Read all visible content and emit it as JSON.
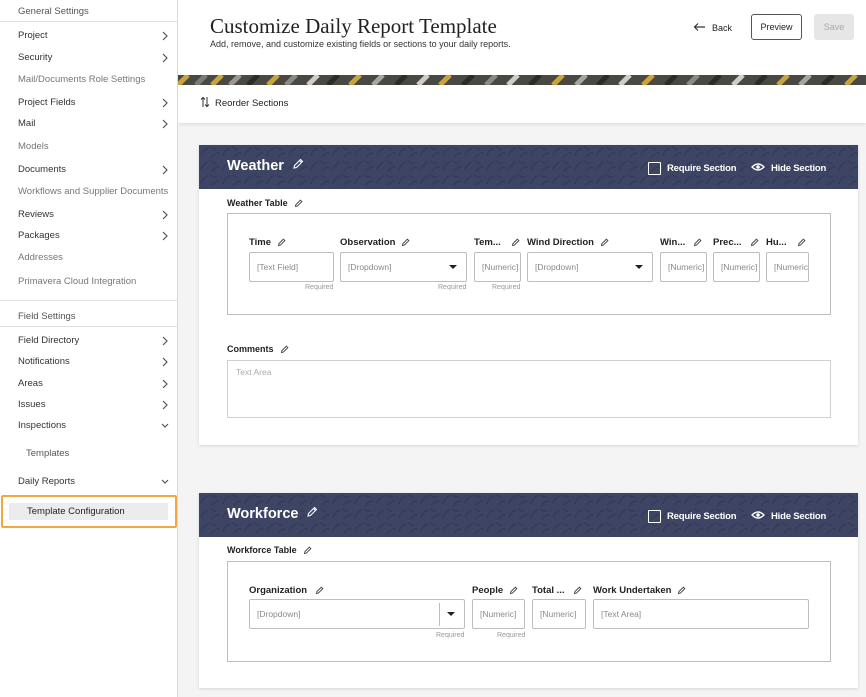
{
  "sidebar": {
    "general_heading": "General Settings",
    "general_items": [
      {
        "label": "Project",
        "chevron": "right"
      },
      {
        "label": "Security",
        "chevron": "right"
      },
      {
        "label": "Mail/Documents Role Settings",
        "chevron": ""
      },
      {
        "label": "Project Fields",
        "chevron": "right"
      },
      {
        "label": "Mail",
        "chevron": "right"
      },
      {
        "label": "Models",
        "chevron": ""
      },
      {
        "label": "Documents",
        "chevron": "right"
      },
      {
        "label": "Workflows and Supplier Documents",
        "chevron": ""
      },
      {
        "label": "Reviews",
        "chevron": "right"
      },
      {
        "label": "Packages",
        "chevron": "right"
      },
      {
        "label": "Addresses",
        "chevron": ""
      },
      {
        "label": "Primavera Cloud Integration",
        "chevron": ""
      }
    ],
    "field_heading": "Field Settings",
    "field_items": [
      {
        "label": "Field Directory",
        "chevron": "right"
      },
      {
        "label": "Notifications",
        "chevron": "right"
      },
      {
        "label": "Areas",
        "chevron": "right"
      },
      {
        "label": "Issues",
        "chevron": "right"
      },
      {
        "label": "Inspections",
        "chevron": "down"
      },
      {
        "label": "Templates",
        "chevron": ""
      },
      {
        "label": "Daily Reports",
        "chevron": "down"
      }
    ],
    "selected_item": "Template Configuration"
  },
  "header": {
    "title": "Customize Daily Report Template",
    "subtitle": "Add, remove, and customize existing fields or sections to your daily reports.",
    "back_label": "Back",
    "preview_label": "Preview",
    "save_label": "Save"
  },
  "toolbar": {
    "reorder_label": "Reorder Sections"
  },
  "sections": {
    "weather": {
      "title": "Weather",
      "require_label": "Require Section",
      "hide_label": "Hide Section",
      "table_label": "Weather Table",
      "columns": [
        {
          "label": "Time",
          "placeholder": "[Text Field]",
          "required": "Required"
        },
        {
          "label": "Observation",
          "placeholder": "[Dropdown]",
          "required": "Required"
        },
        {
          "label": "Tem...",
          "placeholder": "[Numeric]",
          "required": "Required"
        },
        {
          "label": "Wind Direction",
          "placeholder": "[Dropdown]",
          "required": ""
        },
        {
          "label": "Win...",
          "placeholder": "[Numeric]",
          "required": ""
        },
        {
          "label": "Prec...",
          "placeholder": "[Numeric]",
          "required": ""
        },
        {
          "label": "Hu...",
          "placeholder": "[Numeric]",
          "required": ""
        }
      ],
      "comments_label": "Comments",
      "comments_placeholder": "Text Area"
    },
    "workforce": {
      "title": "Workforce",
      "require_label": "Require Section",
      "hide_label": "Hide Section",
      "table_label": "Workforce Table",
      "columns": [
        {
          "label": "Organization",
          "placeholder": "[Dropdown]",
          "required": "Required"
        },
        {
          "label": "People",
          "placeholder": "[Numeric]",
          "required": "Required"
        },
        {
          "label": "Total ...",
          "placeholder": "[Numeric]",
          "required": ""
        },
        {
          "label": "Work Undertaken",
          "placeholder": "[Text Area]",
          "required": ""
        }
      ]
    }
  },
  "colors": {
    "section_header": "#3d4464",
    "selected_highlight": "#f2a93b",
    "banner_dark": "#3d3c3a"
  }
}
